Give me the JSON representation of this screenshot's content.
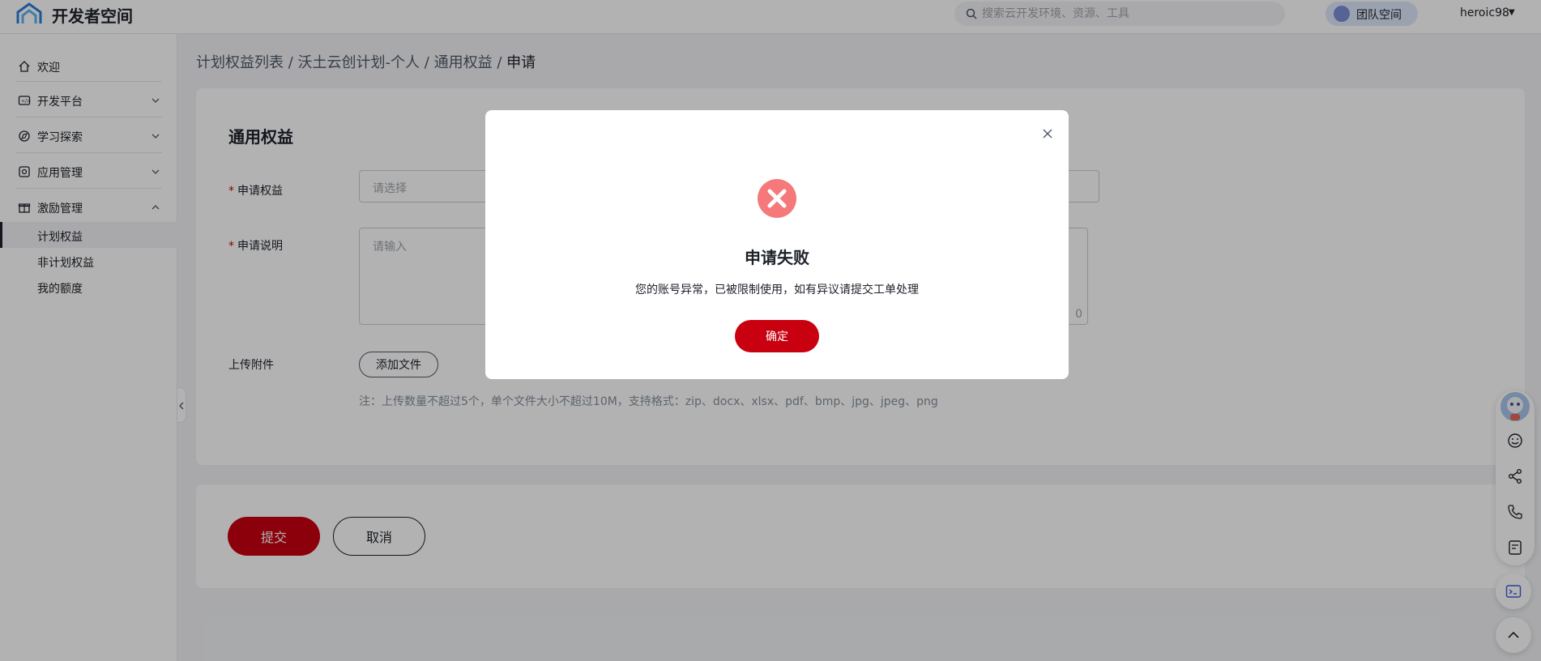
{
  "header": {
    "brand": "开发者空间",
    "search_placeholder": "搜索云开发环境、资源、工具",
    "team_label": "团队空间",
    "username": "heroic98"
  },
  "sidebar": {
    "items": [
      {
        "label": "欢迎",
        "icon": "home-icon"
      },
      {
        "label": "开发平台",
        "icon": "dev-platform-icon"
      },
      {
        "label": "学习探索",
        "icon": "learn-icon"
      },
      {
        "label": "应用管理",
        "icon": "app-manage-icon"
      },
      {
        "label": "激励管理",
        "icon": "gift-icon"
      }
    ],
    "sub_items": [
      {
        "label": "计划权益",
        "active": true
      },
      {
        "label": "非计划权益",
        "active": false
      },
      {
        "label": "我的额度",
        "active": false
      }
    ]
  },
  "breadcrumb": {
    "items": [
      "计划权益列表",
      "沃土云创计划-个人",
      "通用权益"
    ],
    "separator": "/",
    "current": "申请"
  },
  "form": {
    "title": "通用权益",
    "benefit_label": "申请权益",
    "benefit_placeholder": "请选择",
    "desc_label": "申请说明",
    "desc_placeholder": "请输入",
    "desc_count": "0",
    "attach_label": "上传附件",
    "add_file_label": "添加文件",
    "note": "注：上传数量不超过5个，单个文件大小不超过10M，支持格式：zip、docx、xlsx、pdf、bmp、jpg、jpeg、png"
  },
  "actions": {
    "submit": "提交",
    "cancel": "取消"
  },
  "modal": {
    "title": "申请失败",
    "message": "您的账号异常，已被限制使用，如有异议请提交工单处理",
    "ok": "确定"
  },
  "colors": {
    "primary": "#c8000f",
    "error_icon": "#f5797a"
  }
}
